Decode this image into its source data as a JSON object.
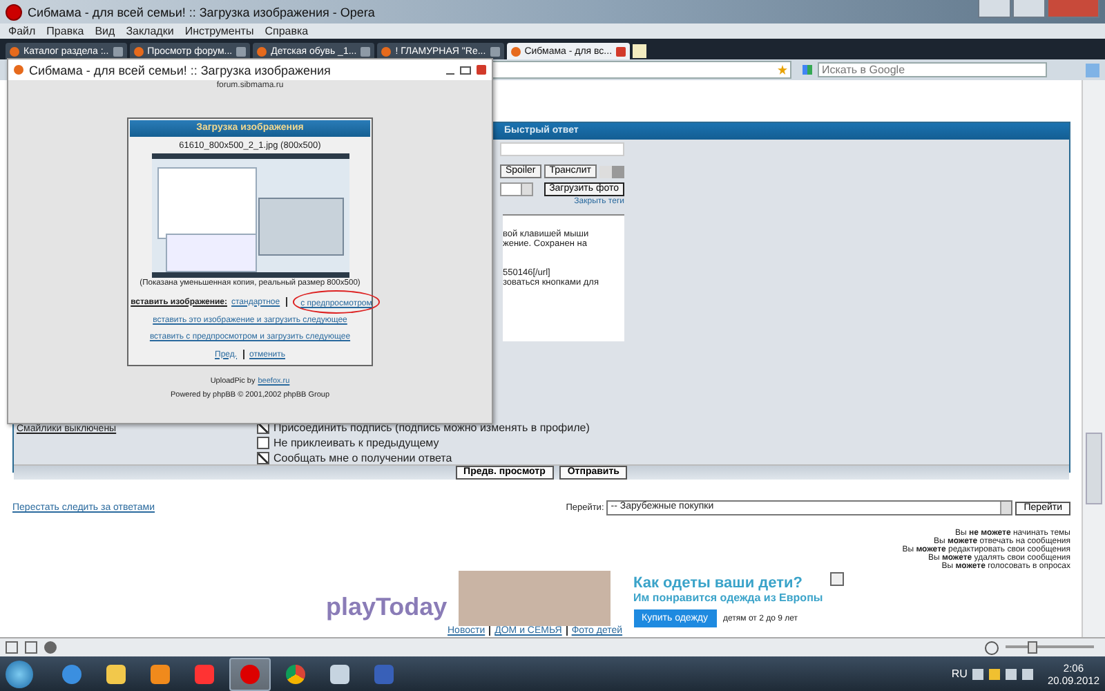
{
  "window": {
    "title": "Сибмама - для всей семьи! :: Загрузка изображения - Opera"
  },
  "menu": [
    "Файл",
    "Правка",
    "Вид",
    "Закладки",
    "Инструменты",
    "Справка"
  ],
  "tabs": [
    {
      "label": "Каталог раздела :..",
      "selected": false
    },
    {
      "label": "Просмотр форум...",
      "selected": false
    },
    {
      "label": "Детская обувь _1...",
      "selected": false
    },
    {
      "label": "! ГЛАМУРНАЯ \"Re...",
      "selected": false
    },
    {
      "label": "Сибмама - для вс...",
      "selected": true
    }
  ],
  "search": {
    "placeholder": "Искать в Google"
  },
  "quick_reply": {
    "title": "Быстрый ответ",
    "toolbar_buttons": [
      "Spoiler",
      "Транслит"
    ],
    "upload_button": "Загрузить фото",
    "close_tags_link": "Закрыть теги",
    "hint_lines": [
      "вой клавишей мыши",
      "жение. Сохранен на",
      "550146[/url]",
      "зоваться кнопками для"
    ],
    "smilies_label": "Смайлики выключены",
    "options": [
      {
        "label": "Присоединить подпись (подпись можно изменять в профиле)",
        "checked": true
      },
      {
        "label": "Не приклеивать к предыдущему",
        "checked": false
      },
      {
        "label": "Сообщать мне о получении ответа",
        "checked": true
      }
    ],
    "buttons": [
      "Предв. просмотр",
      "Отправить"
    ]
  },
  "footer": {
    "unwatch_link": "Перестать следить за ответами",
    "jump_label": "Перейти:",
    "jump_value": "-- Зарубежные покупки",
    "jump_button": "Перейти",
    "permissions": [
      "Вы **не можете** начинать темы",
      "Вы **можете** отвечать на сообщения",
      "Вы **можете** редактировать свои сообщения",
      "Вы **можете** удалять свои сообщения",
      "Вы **можете** голосовать в опросах"
    ]
  },
  "ad": {
    "logo": "playToday",
    "headline": "Как одеты ваши дети?",
    "subline": "Им понравится одежда из Европы",
    "button": "Купить одежду",
    "note": "детям от 2 до 9 лет",
    "links": [
      "Новости",
      "ДОМ и СЕМЬЯ",
      "Фото детей"
    ]
  },
  "popup": {
    "title": "Сибмама - для всей семьи! :: Загрузка изображения",
    "address": "forum.sibmama.ru",
    "heading": "Загрузка изображения",
    "file": "61610_800x500_2_1.jpg (800x500)",
    "caption": "(Показана уменьшенная копия, реальный размер 800x500)",
    "insert_label": "вставить изображение:",
    "insert_links": [
      "стандартное",
      "с предпросмотром"
    ],
    "action_links": [
      "вставить это изображение и загрузить следующее",
      "вставить с предпросмотром и загрузить следующее"
    ],
    "nav_links": [
      "Пред.",
      "отменить"
    ],
    "credit": "UploadPic by",
    "credit_link": "beefox.ru",
    "powered": "Powered by phpBB © 2001,2002 phpBB Group"
  },
  "zoom": {
    "level": 0.3
  },
  "taskbar": {
    "language": "RU",
    "time": "2:06",
    "date": "20.09.2012"
  }
}
